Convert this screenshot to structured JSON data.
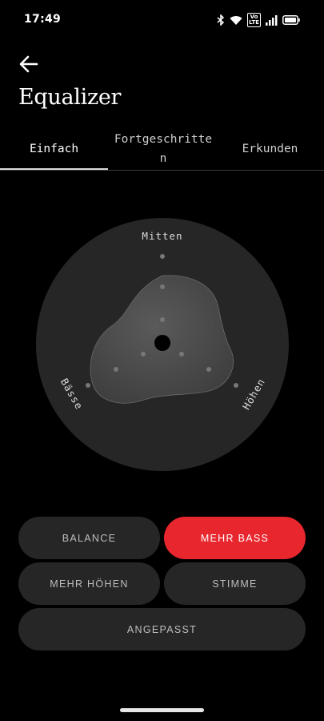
{
  "status_bar": {
    "time": "17:49",
    "icons": [
      "bluetooth-icon",
      "wifi-icon",
      "volte-icon",
      "signal-icon",
      "battery-icon"
    ],
    "volte_label": "Vo LTE"
  },
  "header": {
    "back_icon": "arrow-left-icon",
    "title": "Equalizer"
  },
  "tabs": [
    {
      "label": "Einfach",
      "active": true
    },
    {
      "label": "Fortgeschritten",
      "active": false
    },
    {
      "label": "Erkunden",
      "active": false
    }
  ],
  "equalizer": {
    "axes": {
      "mid": "Mitten",
      "bass": "Bässe",
      "treble": "Höhen"
    },
    "levels": {
      "mid": 0.58,
      "bass": 0.5,
      "treble": 0.5
    },
    "colors": {
      "dial": "#262626",
      "blob": "#4b4b4b",
      "dots": "#777777"
    }
  },
  "presets": [
    {
      "label": "BALANCE",
      "selected": false
    },
    {
      "label": "MEHR BASS",
      "selected": true
    },
    {
      "label": "MEHR HÖHEN",
      "selected": false
    },
    {
      "label": "STIMME",
      "selected": false
    },
    {
      "label": "ANGEPASST",
      "selected": false
    }
  ],
  "colors": {
    "accent": "#e8262e",
    "button_bg": "#262626",
    "background": "#000000"
  }
}
